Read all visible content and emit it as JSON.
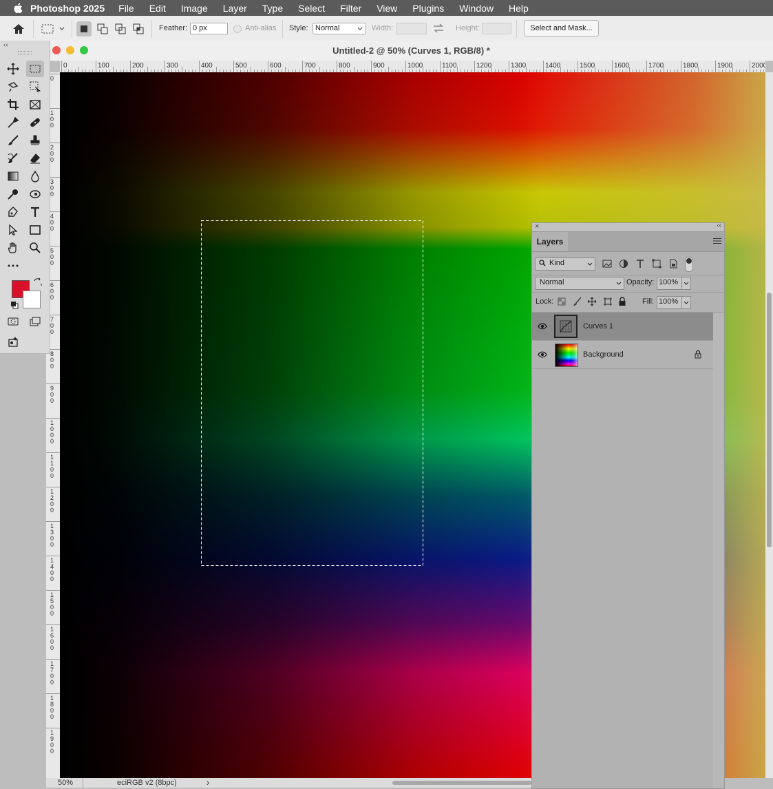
{
  "menubar": {
    "app_name": "Photoshop 2025",
    "items": [
      "File",
      "Edit",
      "Image",
      "Layer",
      "Type",
      "Select",
      "Filter",
      "View",
      "Plugins",
      "Window",
      "Help"
    ]
  },
  "options": {
    "feather_label": "Feather:",
    "feather_value": "0 px",
    "antialias_label": "Anti-alias",
    "style_label": "Style:",
    "style_value": "Normal",
    "width_label": "Width:",
    "height_label": "Height:",
    "select_mask_label": "Select and Mask..."
  },
  "document": {
    "title": "Untitled-2 @ 50% (Curves 1, RGB/8) *"
  },
  "ruler": {
    "h_labels": [
      "0",
      "100",
      "200",
      "300",
      "400",
      "500",
      "600",
      "700",
      "800",
      "900",
      "1000",
      "1100",
      "1200",
      "1300",
      "1400",
      "1500",
      "1600",
      "1700",
      "1800",
      "1900",
      "2000"
    ],
    "v_labels": [
      "0",
      "1\n0\n0",
      "2\n0\n0",
      "3\n0\n0",
      "4\n0\n0",
      "5\n0\n0",
      "6\n0\n0",
      "7\n0\n0",
      "8\n0\n0",
      "9\n0\n0",
      "1\n0\n0\n0",
      "1\n1\n0\n0",
      "1\n2\n0\n0",
      "1\n3\n0\n0",
      "1\n4\n0\n0",
      "1\n5\n0\n0",
      "1\n6\n0\n0",
      "1\n7\n0\n0",
      "1\n8\n0\n0",
      "1\n9\n0\n0"
    ]
  },
  "colors": {
    "foreground": "#d8102a",
    "background": "#ffffff"
  },
  "layers_panel": {
    "title": "Layers",
    "filter_kind": "Kind",
    "blend_mode": "Normal",
    "opacity_label": "Opacity:",
    "opacity_value": "100%",
    "lock_label": "Lock:",
    "fill_label": "Fill:",
    "fill_value": "100%",
    "layers": [
      {
        "name": "Curves 1",
        "selected": true,
        "visible": true,
        "type": "adjustment"
      },
      {
        "name": "Background",
        "selected": false,
        "visible": true,
        "locked": true,
        "type": "image"
      }
    ]
  },
  "status": {
    "zoom": "50%",
    "profile": "eciRGB v2 (8bpc)"
  }
}
